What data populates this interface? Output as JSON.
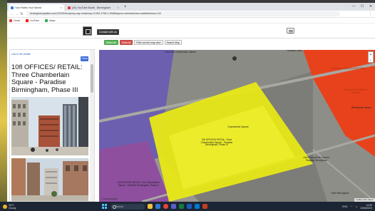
{
  "browser": {
    "tabs": [
      {
        "label": "Your Rates Your Saved",
        "active": true
      },
      {
        "label": "(26) YouTube Booth - Birmingham",
        "active": false
      }
    ],
    "new_tab": "+",
    "url": "birminghamupdates.com/2023/03/map/my-map.html#map=0.0/52.4795/-1.9068&layers=outlines&view=satellite&show=10f",
    "bookmarks": [
      "Gmail",
      "YouTube",
      "Maps"
    ]
  },
  "site": {
    "contact_button": "Contact with us"
  },
  "toolbar": {
    "buttons": [
      "Select all",
      "Clear all",
      "Filter current map view",
      "Search Map"
    ]
  },
  "panel": {
    "link": "Link to the Details",
    "close": "Close",
    "title": "10fl OFFICES/ RETAIL: Three Chamberlain Square - Paradise Birmingham, Phase III"
  },
  "map": {
    "labels": {
      "top_centre": "Town Hall Chamberlain Square",
      "top_right": "Paradise Place",
      "right_a": "Birmingham Museum & Art Gallery",
      "right_b": "Birmingham & Midland Institute",
      "right_c": "Birmingham Library",
      "centre": "10fl OFFICES/ RETAIL: Three Chamberlain Square - Paradise Birmingham, Phase III",
      "mid_small": "Chamberlain Square",
      "right_mid": "One Chamberlain Square, Paradise Birmingham",
      "bottom_left": "12fl OFFICES/ RETAIL: Two Chamberlain Square - Paradise Birmingham, Phase II",
      "bottom_right": "Hotel Birmingham"
    },
    "zoom_in": "+",
    "zoom_out": "−",
    "scale": "© OpenStreetMap",
    "attribution": "Leaflet | Esri, Maxar"
  },
  "taskbar": {
    "weather_temp": "16°C",
    "weather_desc": "Cloudy",
    "search_placeholder": "Search",
    "time": "14:59",
    "date": "10/06/2023",
    "lang": "ENG"
  },
  "colors": {
    "yellow_outline": "#e8e817",
    "red_area": "#e8421c",
    "purple_area": "#6d5fb0",
    "grey_area": "#8a8a86"
  }
}
